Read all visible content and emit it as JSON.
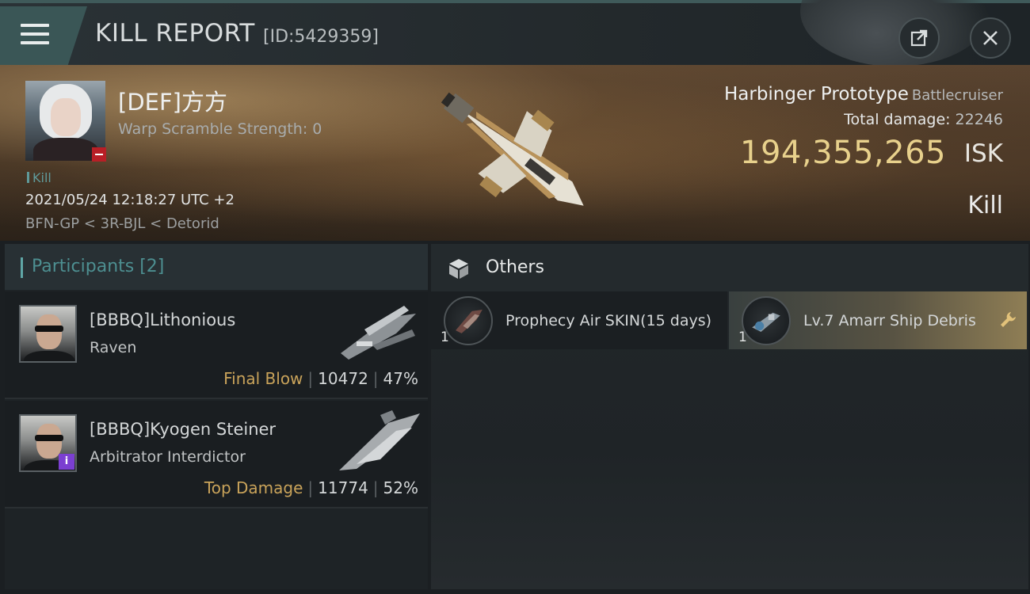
{
  "header": {
    "title": "KILL REPORT",
    "report_id": "[ID:5429359]",
    "icons": [
      "menu-icon",
      "share-icon",
      "close-icon"
    ]
  },
  "victim": {
    "name": "[DEF]方方",
    "warp_scramble": "Warp Scramble Strength: 0",
    "kill_tag": "Kill",
    "datetime": "2021/05/24 12:18:27 UTC +2",
    "location": "BFN-GP < 3R-BJL < Detorid"
  },
  "ship": {
    "name": "Harbinger Prototype",
    "class": "Battlecruiser",
    "total_damage_label": "Total damage:",
    "total_damage": "22246",
    "isk_value": "194,355,265",
    "isk_unit": "ISK",
    "result": "Kill"
  },
  "participants": {
    "header": "Participants [2]",
    "items": [
      {
        "name": "[BBBQ]Lithonious",
        "ship": "Raven",
        "tag": "Final Blow",
        "damage": "10472",
        "percent": "47%"
      },
      {
        "name": "[BBBQ]Kyogen Steiner",
        "ship": "Arbitrator Interdictor",
        "tag": "Top Damage",
        "damage": "11774",
        "percent": "52%",
        "badge": "i"
      }
    ]
  },
  "others": {
    "header": "Others",
    "items": [
      {
        "name": "Prophecy Air SKIN(15 days)",
        "qty": "1"
      },
      {
        "name": "Lv.7 Amarr Ship Debris",
        "qty": "1"
      }
    ]
  },
  "colors": {
    "accent_teal": "#3a5656",
    "isk_gold": "#e8d18c",
    "tag_gold": "#c9a35a",
    "victim_badge_red": "#b81f26",
    "info_badge_purple": "#7b3fd1"
  }
}
